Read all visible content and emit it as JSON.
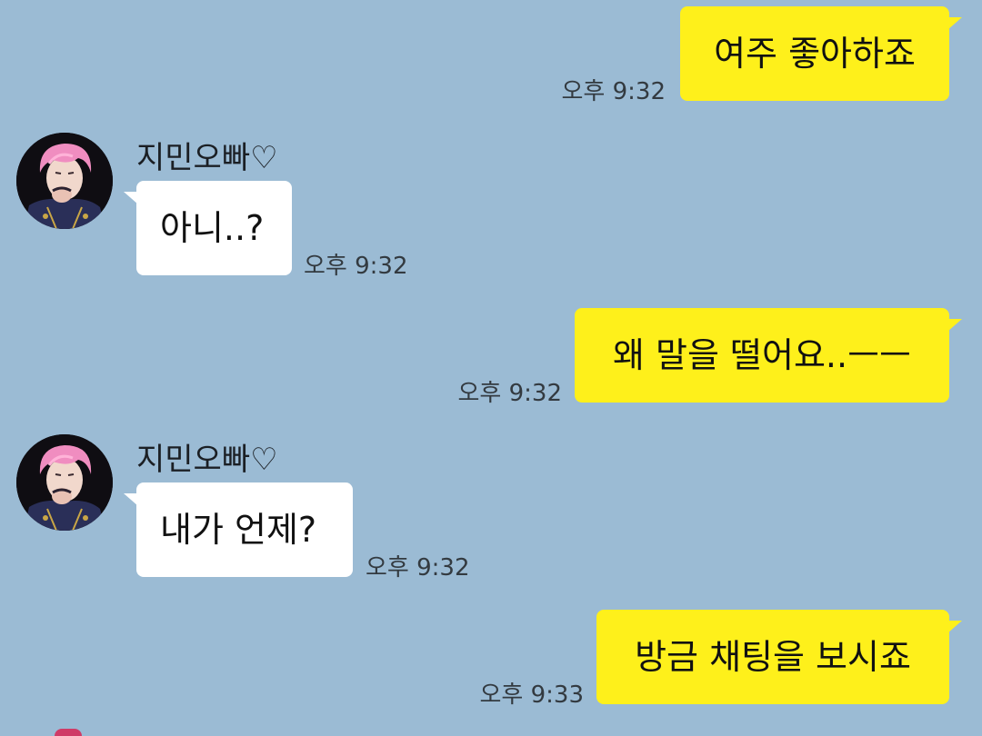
{
  "chat": {
    "messages": [
      {
        "from": "me",
        "text": "여주 좋아하죠",
        "time": "오후 9:32"
      },
      {
        "from": "other",
        "sender": "지민오빠♡",
        "text": "아니..?",
        "time": "오후 9:32"
      },
      {
        "from": "me",
        "text": "왜 말을 떨어요..ㅡㅡ",
        "time": "오후 9:32"
      },
      {
        "from": "other",
        "sender": "지민오빠♡",
        "text": "내가 언제?",
        "time": "오후 9:32"
      },
      {
        "from": "me",
        "text": "방금 채팅을 보시죠",
        "time": "오후 9:33"
      }
    ]
  },
  "colors": {
    "background": "#9bbbd4",
    "my_bubble": "#fef01b",
    "their_bubble": "#ffffff"
  },
  "icons": {
    "avatar": "profile-photo-pink-hair"
  }
}
